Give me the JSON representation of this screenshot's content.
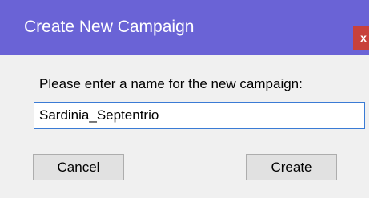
{
  "dialog": {
    "title": "Create New Campaign",
    "close_label": "x",
    "prompt": "Please enter a name for the new campaign:",
    "name_value": "Sardinia_Septentrio",
    "cancel_label": "Cancel",
    "create_label": "Create"
  },
  "colors": {
    "titlebar": "#6a63d6",
    "close_button": "#c8413b",
    "dialog_background": "#f0f0f0",
    "input_border": "#3a7bd5"
  },
  "icons": {
    "close": "close-icon"
  }
}
